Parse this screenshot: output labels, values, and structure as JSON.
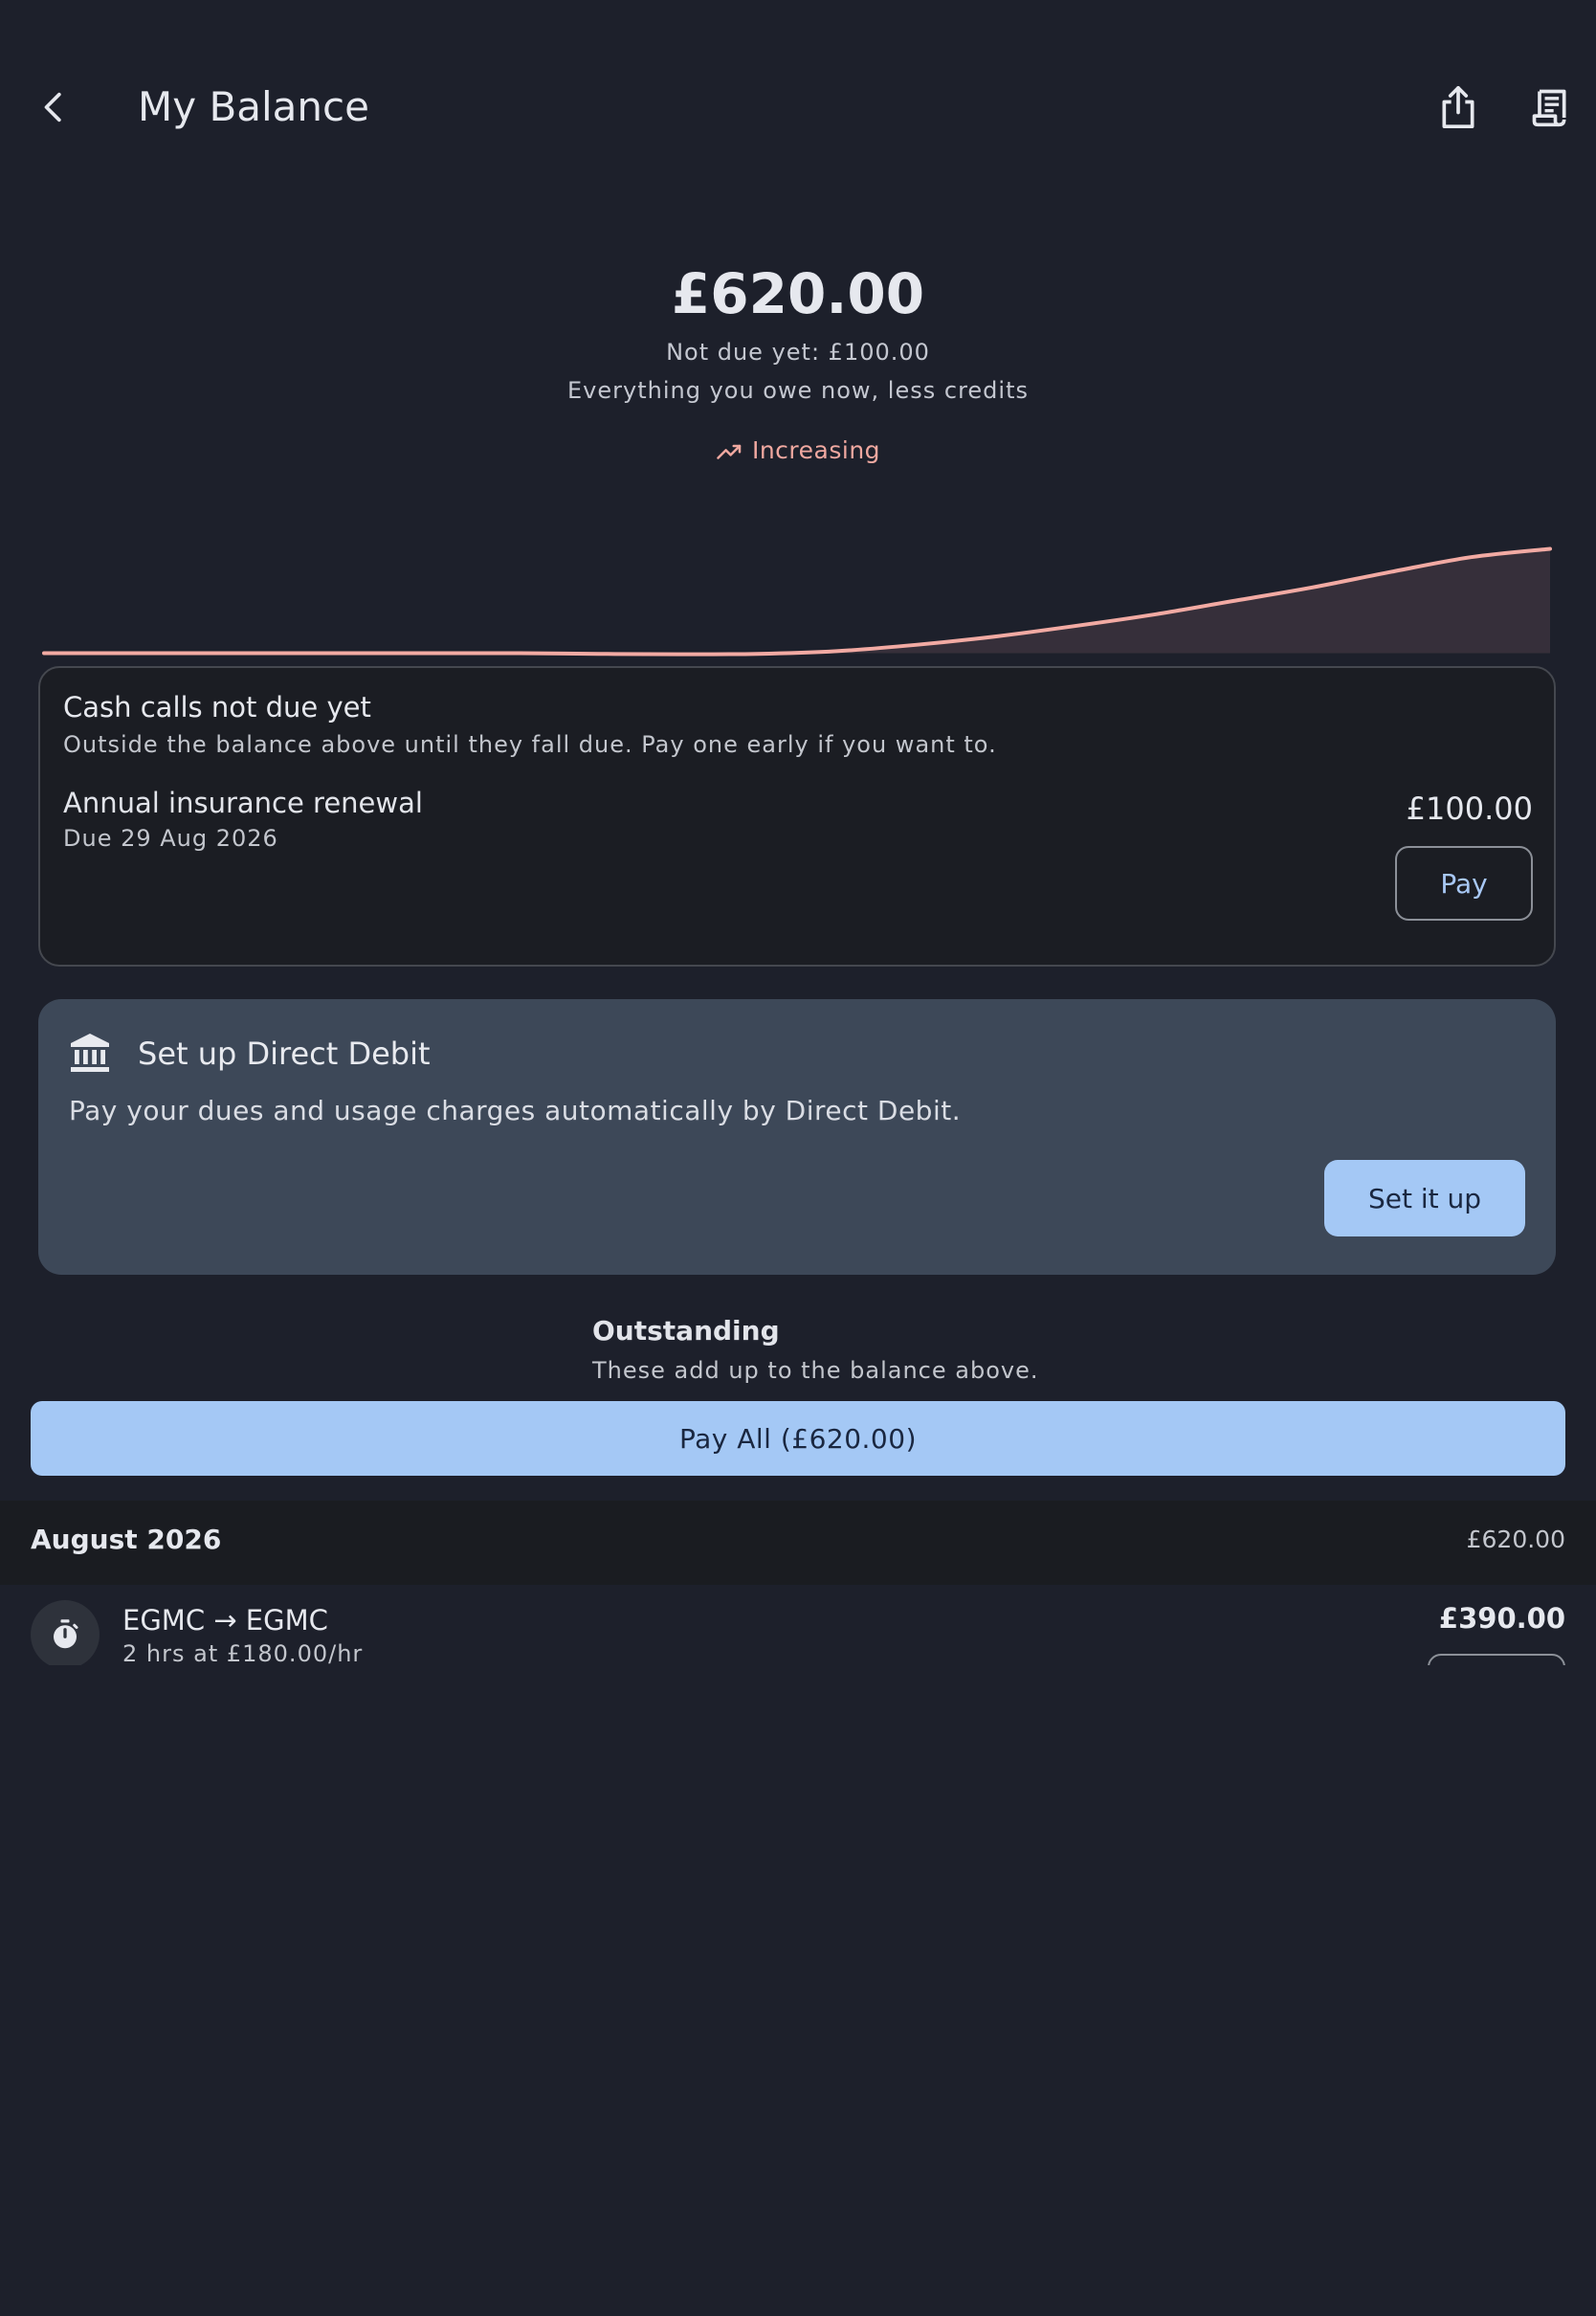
{
  "header": {
    "title": "My Balance",
    "back_icon": "chevron-left-icon",
    "share_icon": "share-icon",
    "statement_icon": "receipt-icon"
  },
  "balance": {
    "amount": "£620.00",
    "not_due": "Not due yet: £100.00",
    "description": "Everything you owe now, less credits",
    "trend_label": "Increasing",
    "trend_icon": "trending-up-icon",
    "trend_color": "#f0a8a0"
  },
  "chart_data": {
    "type": "area",
    "title": "",
    "xlabel": "",
    "ylabel": "",
    "grid": false,
    "series": [
      {
        "values": [
          0,
          0,
          0,
          0,
          0,
          0,
          0,
          -0.6,
          -1,
          -0.6,
          2,
          8,
          16,
          26,
          37,
          50,
          63,
          78,
          92,
          100
        ]
      }
    ],
    "ylim": [
      -5,
      105
    ],
    "line_color": "#f2aaa3"
  },
  "cash_calls": {
    "title": "Cash calls not due yet",
    "description": "Outside the balance above until they fall due. Pay one early if you want to.",
    "items": [
      {
        "title": "Annual insurance renewal",
        "due": "Due 29 Aug 2026",
        "amount": "£100.00",
        "pay_label": "Pay"
      }
    ]
  },
  "direct_debit": {
    "icon": "bank-icon",
    "title": "Set up Direct Debit",
    "description": "Pay your dues and usage charges automatically by Direct Debit.",
    "button_label": "Set it up"
  },
  "outstanding": {
    "title": "Outstanding",
    "description": "These add up to the balance above.",
    "pay_all_label": "Pay All (£620.00)"
  },
  "months": [
    {
      "label": "August 2026",
      "total": "£620.00",
      "transactions": [
        {
          "icon": "timer-icon",
          "title": "EGMC → EGMC",
          "subtitle": "2 hrs at £180.00/hr",
          "amount": "£390.00"
        }
      ]
    }
  ],
  "colors": {
    "background": "#1d202b",
    "accent": "#a4c8f5",
    "card": "#3d4858"
  }
}
